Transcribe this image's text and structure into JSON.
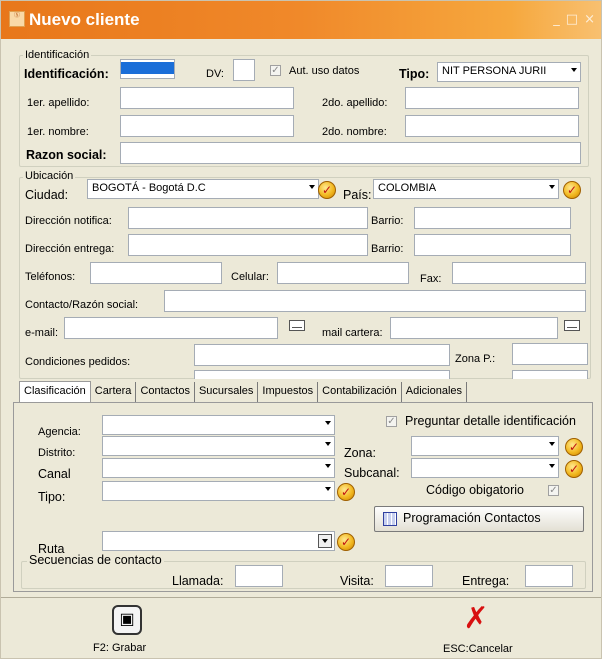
{
  "window": {
    "title": "Nuevo cliente",
    "app_icon_text": "Ⓢ",
    "minimize": "_",
    "maximize": "□",
    "close": "×"
  },
  "identificacion": {
    "group_title": "Identificación",
    "id_label": "Identificación:",
    "dv_label": "DV:",
    "aut_label": "Aut. uso datos",
    "tipo_label": "Tipo:",
    "tipo_value": "NIT PERSONA JURII",
    "apellido1_label": "1er. apellido:",
    "apellido2_label": "2do. apellido:",
    "nombre1_label": "1er. nombre:",
    "nombre2_label": "2do. nombre:",
    "razon_label": "Razon social:"
  },
  "ubicacion": {
    "group_title": "Ubicación",
    "ciudad_label": "Ciudad:",
    "ciudad_value": "BOGOTÁ - Bogotá D.C",
    "pais_label": "País:",
    "pais_value": "COLOMBIA",
    "dir_notifica_label": "Dirección notifica:",
    "barrio_label": "Barrio:",
    "dir_entrega_label": "Dirección entrega:",
    "telefonos_label": "Teléfonos:",
    "celular_label": "Celular:",
    "fax_label": "Fax:",
    "contacto_label": "Contacto/Razón social:",
    "email_label": "e-mail:",
    "mail_cartera_label": "mail cartera:",
    "condiciones_label": "Condiciones pedidos:",
    "zona_p_label": "Zona P.:"
  },
  "tabs": [
    "Clasificación",
    "Cartera",
    "Contactos",
    "Sucursales",
    "Impuestos",
    "Contabilización",
    "Adicionales"
  ],
  "clasificacion": {
    "agencia_label": "Agencia:",
    "distrito_label": "Distrito:",
    "canal_label": "Canal",
    "tipo_label": "Tipo:",
    "zona_label": "Zona:",
    "subcanal_label": "Subcanal:",
    "preguntar_label": "Preguntar detalle identificación",
    "codigo_label": "Código obigatorio",
    "prog_button": "Programación Contactos",
    "ruta_label": "Ruta",
    "secuencias_title": "Secuencias de contacto",
    "llamada_label": "Llamada:",
    "visita_label": "Visita:",
    "entrega_label": "Entrega:"
  },
  "footer": {
    "save_label": "F2: Grabar",
    "cancel_label": "ESC:Cancelar"
  },
  "colors": {
    "title_bar": "#f0892a",
    "window_bg": "#ece9d8",
    "id_input_fill": "#1a6ed8"
  }
}
